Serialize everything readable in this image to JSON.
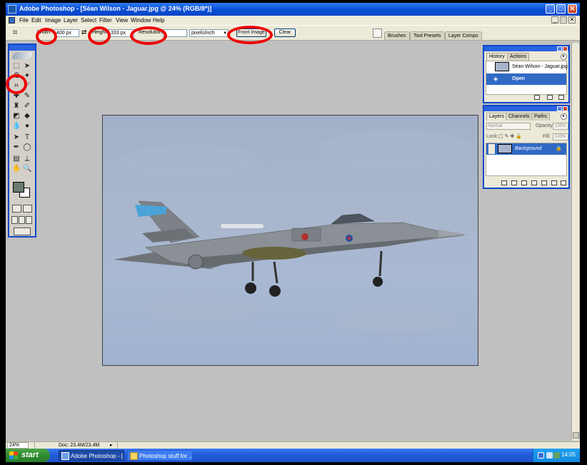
{
  "window": {
    "title": "Adobe Photoshop - [Séan Wilson - Jaguar.jpg @ 24% (RGB/8*)]",
    "controls": [
      "_",
      "□",
      "✕"
    ]
  },
  "menu": {
    "items": [
      "File",
      "Edit",
      "Image",
      "Layer",
      "Select",
      "Filter",
      "View",
      "Window",
      "Help"
    ],
    "doc_controls": [
      "_",
      "□",
      "✕"
    ]
  },
  "options_bar": {
    "width_label": "Width:",
    "width_value": "400 px",
    "height_label": "Height:",
    "height_value": "333 px",
    "resolution_label": "Resolution:",
    "resolution_value": "",
    "resolution_unit": "pixels/inch",
    "front_image_button": "Front Image",
    "clear_button": "Clear",
    "swap_glyph": "⇄",
    "well_tabs": [
      "Brushes",
      "Tool Presets",
      "Layer Comps"
    ]
  },
  "history_panel": {
    "tabs": [
      "History",
      "Actions"
    ],
    "snapshot_label": "Séan Wilson - Jaguar.jpg",
    "states": [
      "Open"
    ]
  },
  "layers_panel": {
    "tabs": [
      "Layers",
      "Channels",
      "Paths"
    ],
    "blend_mode": "Normal",
    "opacity_label": "Opacity:",
    "opacity_value": "100%",
    "lock_label": "Lock:",
    "fill_label": "Fill:",
    "fill_value": "100%",
    "layers": [
      "Background"
    ]
  },
  "status_bar": {
    "zoom": "24%",
    "doc_info": "Doc: 23.4M/23.4M"
  },
  "taskbar": {
    "start_label": "start",
    "tasks": [
      "Adobe Photoshop - [...",
      "Photoshop stuff for ..."
    ],
    "clock": "14:05"
  },
  "colors": {
    "foreground": "#6c7a70",
    "background": "#ffffff",
    "annotation": "#ee0000",
    "xp_blue": "#0b47c8"
  }
}
